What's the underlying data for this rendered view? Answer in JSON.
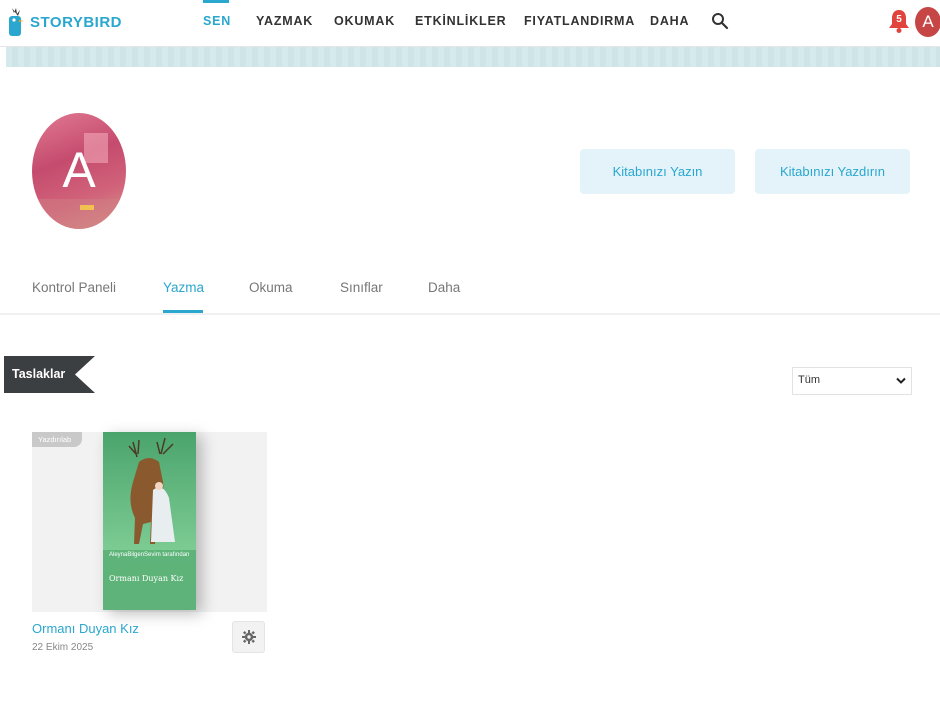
{
  "brand": {
    "name": "STORYBIRD",
    "color": "#2aa7cf"
  },
  "nav": {
    "items": [
      {
        "label": "SEN",
        "active": true
      },
      {
        "label": "YAZMAK"
      },
      {
        "label": "OKUMAK"
      },
      {
        "label": "ETKİNLİKLER"
      },
      {
        "label": "FIYATLANDIRMA"
      },
      {
        "label": "DAHA"
      }
    ],
    "search_icon": "search-icon",
    "notification_count": "5",
    "avatar_letter": "A"
  },
  "profile": {
    "avatar_letter": "A",
    "buttons": [
      {
        "label": "Kitabınızı Yazın"
      },
      {
        "label": "Kitabınızı Yazdırın"
      }
    ]
  },
  "tabs": [
    {
      "label": "Kontrol Paneli"
    },
    {
      "label": "Yazma",
      "active": true
    },
    {
      "label": "Okuma"
    },
    {
      "label": "Sınıflar"
    },
    {
      "label": "Daha"
    }
  ],
  "section": {
    "title": "Taslaklar",
    "filter": {
      "selected": "Tüm"
    }
  },
  "books": [
    {
      "badge": "Yazdırılab",
      "cover_author": "AleynaBilgenSevim tarafından",
      "cover_title": "Ormanı Duyan Kız",
      "title": "Ormanı Duyan Kız",
      "date": "22 Ekim 2025"
    }
  ],
  "colors": {
    "accent": "#2aa7cf",
    "ribbon": "#3c3f42",
    "bell": "#e0443c"
  }
}
